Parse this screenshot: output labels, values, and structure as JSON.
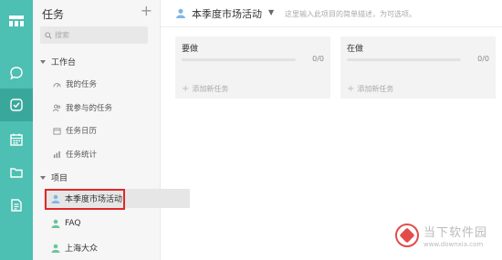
{
  "rail": {
    "items": [
      {
        "icon": "grid-menu-icon",
        "active": false
      },
      {
        "icon": "chat-bubble-icon",
        "active": false
      },
      {
        "icon": "task-check-icon",
        "active": true
      },
      {
        "icon": "calendar-icon",
        "active": false
      },
      {
        "icon": "folder-icon",
        "active": false
      },
      {
        "icon": "document-icon",
        "active": false
      }
    ],
    "color": "#4dbfb3",
    "active_color": "#3aa79c"
  },
  "sidebar": {
    "title": "任务",
    "add_label": "+",
    "search_placeholder": "搜索",
    "workbench": {
      "label": "工作台",
      "items": [
        {
          "label": "我的任务",
          "icon": "dashboard-icon"
        },
        {
          "label": "我参与的任务",
          "icon": "people-icon"
        },
        {
          "label": "任务日历",
          "icon": "calendar-small-icon"
        },
        {
          "label": "任务统计",
          "icon": "bar-chart-icon"
        }
      ]
    },
    "projects": {
      "label": "项目",
      "items": [
        {
          "label": "本季度市场活动",
          "icon": "person-icon",
          "active": true
        },
        {
          "label": "FAQ",
          "icon": "person-icon",
          "active": false
        },
        {
          "label": "上海大众",
          "icon": "person-icon",
          "active": false
        }
      ]
    }
  },
  "header": {
    "title": "本季度市场活动",
    "description": "这里输入此项目的简单描述，为可选项。"
  },
  "board": {
    "columns": [
      {
        "title": "要做",
        "count": "0/0",
        "progress": 0,
        "add_label": "添加新任务"
      },
      {
        "title": "在做",
        "count": "0/0",
        "progress": 0,
        "add_label": "添加新任务"
      }
    ]
  },
  "watermark": {
    "name": "当下软件园",
    "url": "www.downxia.com"
  }
}
